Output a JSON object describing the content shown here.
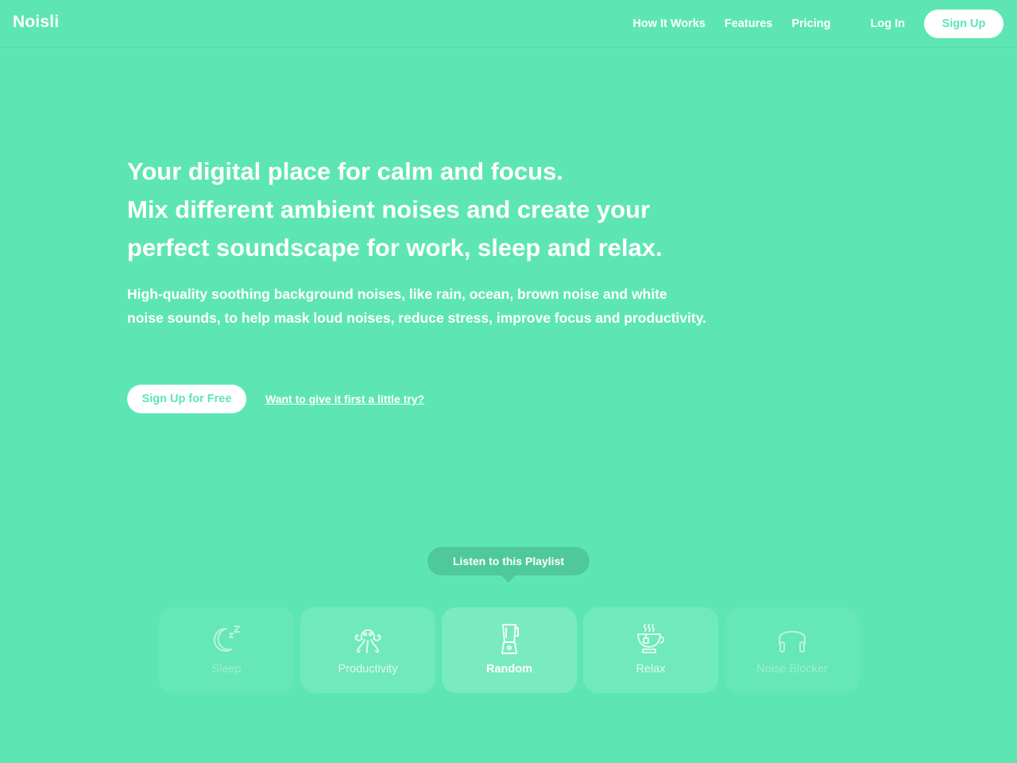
{
  "header": {
    "logo": "Noisli",
    "nav": [
      "How It Works",
      "Features",
      "Pricing"
    ],
    "login": "Log In",
    "signup": "Sign Up"
  },
  "hero": {
    "headline": [
      "Your digital place for calm and focus.",
      "Mix different ambient noises and create your",
      "perfect soundscape for work, sleep and relax."
    ],
    "description": [
      "High-quality soothing background noises, like rain, ocean, brown noise and white",
      "noise sounds, to help mask loud noises, reduce stress, improve focus and productivity."
    ],
    "cta_primary": "Sign Up for Free",
    "cta_secondary": "Want to give it first a little try?"
  },
  "playlist": {
    "tooltip": "Listen to this Playlist",
    "cards": [
      {
        "label": "Sleep",
        "icon": "moon-sleep-icon",
        "state": "faint"
      },
      {
        "label": "Productivity",
        "icon": "octopus-icon",
        "state": "mid"
      },
      {
        "label": "Random",
        "icon": "blender-icon",
        "state": "active"
      },
      {
        "label": "Relax",
        "icon": "tea-cup-icon",
        "state": "mid"
      },
      {
        "label": "Noise Blocker",
        "icon": "headphones-icon",
        "state": "faint"
      }
    ]
  },
  "colors": {
    "background": "#5de6b4",
    "tooltip": "#4fc99c",
    "button_text": "#5de6b4"
  }
}
